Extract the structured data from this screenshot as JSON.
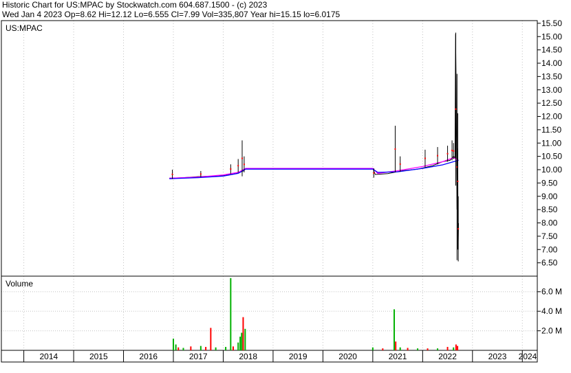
{
  "header": {
    "line1": "Historic Chart for US:MPAC by Stockwatch.com 604.687.1500 - (c) 2023",
    "line2": "Wed Jan  4 2023   Op=8.62  Hi=12.12  Lo=6.555  Cl=7.99  Vol=335,807  Year hi=15.15  lo=6.0175"
  },
  "colors": {
    "price": "#000000",
    "down_tick": "#ff0000",
    "ma_fast": "#ff00ff",
    "ma_slow": "#0000ff",
    "vol_up": "#00b000",
    "vol_down": "#ff0000",
    "grid": "#c0c0c0"
  },
  "chart_data": [
    {
      "type": "line",
      "symbol_label": "US:MPAC",
      "y_ticks": [
        "15.50",
        "15.00",
        "14.50",
        "14.00",
        "13.50",
        "13.00",
        "12.50",
        "12.00",
        "11.50",
        "11.00",
        "10.50",
        "10.00",
        "9.50",
        "9.00",
        "8.50",
        "8.00",
        "7.50",
        "7.00",
        "6.50"
      ],
      "ylim": [
        6.0,
        15.6
      ],
      "x_ticks": [
        "2014",
        "2015",
        "2016",
        "2017",
        "2018",
        "2019",
        "2020",
        "2021",
        "2022",
        "2023",
        "2024"
      ],
      "xlim": [
        2013.55,
        2024.3
      ],
      "series": [
        {
          "role": "close",
          "x": [
            2016.92,
            2017.2,
            2017.5,
            2017.8,
            2018.05,
            2018.25,
            2018.4,
            2018.45,
            2021.0,
            2021.05,
            2021.3,
            2021.6,
            2021.9,
            2022.2,
            2022.4,
            2022.55,
            2022.62,
            2022.65,
            2022.66,
            2022.67,
            2022.69,
            2022.7,
            2022.705,
            2022.71,
            2022.72
          ],
          "values": [
            9.68,
            9.7,
            9.74,
            9.76,
            9.79,
            9.85,
            9.95,
            10.05,
            10.05,
            9.82,
            9.85,
            9.96,
            10.02,
            10.15,
            10.3,
            10.35,
            10.5,
            10.45,
            15.1,
            13.5,
            8.5,
            9.1,
            10.8,
            7.0,
            7.99
          ]
        },
        {
          "role": "ma_fast",
          "x": [
            2016.92,
            2017.5,
            2018.0,
            2018.3,
            2018.45,
            2021.0,
            2021.1,
            2021.5,
            2022.0,
            2022.4,
            2022.62,
            2022.72
          ],
          "values": [
            9.68,
            9.72,
            9.8,
            9.9,
            10.05,
            10.05,
            9.86,
            9.96,
            10.12,
            10.3,
            10.45,
            10.35
          ]
        },
        {
          "role": "ma_slow",
          "x": [
            2016.92,
            2017.5,
            2018.0,
            2018.3,
            2018.45,
            2021.0,
            2021.1,
            2021.5,
            2022.0,
            2022.4,
            2022.62,
            2022.72
          ],
          "values": [
            9.66,
            9.7,
            9.76,
            9.86,
            10.02,
            10.02,
            9.9,
            9.92,
            10.05,
            10.18,
            10.3,
            10.35
          ]
        }
      ],
      "spikes": [
        {
          "x": 2016.98,
          "lo": 9.65,
          "hi": 10.0
        },
        {
          "x": 2017.55,
          "lo": 9.72,
          "hi": 9.95
        },
        {
          "x": 2018.15,
          "lo": 9.85,
          "hi": 10.2
        },
        {
          "x": 2018.3,
          "lo": 9.9,
          "hi": 10.4
        },
        {
          "x": 2018.38,
          "lo": 9.75,
          "hi": 11.1
        },
        {
          "x": 2018.42,
          "lo": 9.9,
          "hi": 10.5
        },
        {
          "x": 2021.02,
          "lo": 9.7,
          "hi": 10.05
        },
        {
          "x": 2021.45,
          "lo": 9.9,
          "hi": 11.65
        },
        {
          "x": 2021.55,
          "lo": 9.92,
          "hi": 10.5
        },
        {
          "x": 2022.05,
          "lo": 10.1,
          "hi": 10.75
        },
        {
          "x": 2022.3,
          "lo": 10.2,
          "hi": 10.85
        },
        {
          "x": 2022.5,
          "lo": 10.3,
          "hi": 10.9
        },
        {
          "x": 2022.59,
          "lo": 10.35,
          "hi": 11.1
        },
        {
          "x": 2022.62,
          "lo": 10.4,
          "hi": 11.0
        },
        {
          "x": 2022.665,
          "lo": 9.4,
          "hi": 15.15
        },
        {
          "x": 2022.69,
          "lo": 6.6,
          "hi": 13.6
        },
        {
          "x": 2022.705,
          "lo": 7.0,
          "hi": 12.12
        },
        {
          "x": 2022.715,
          "lo": 6.555,
          "hi": 9.0
        }
      ]
    },
    {
      "type": "bar",
      "title": "Volume",
      "y_ticks": [
        "6.0 M",
        "4.0 M",
        "2.0 M"
      ],
      "ylim": [
        0,
        7.6
      ],
      "units": "M",
      "bars": [
        {
          "x": 2017.0,
          "v": 1.2,
          "dir": "up"
        },
        {
          "x": 2017.05,
          "v": 0.6,
          "dir": "up"
        },
        {
          "x": 2017.1,
          "v": 0.3,
          "dir": "down"
        },
        {
          "x": 2017.2,
          "v": 0.25,
          "dir": "up"
        },
        {
          "x": 2017.35,
          "v": 0.4,
          "dir": "down"
        },
        {
          "x": 2017.55,
          "v": 0.45,
          "dir": "up"
        },
        {
          "x": 2017.65,
          "v": 0.35,
          "dir": "down"
        },
        {
          "x": 2017.75,
          "v": 2.3,
          "dir": "down"
        },
        {
          "x": 2017.85,
          "v": 0.3,
          "dir": "up"
        },
        {
          "x": 2018.05,
          "v": 0.35,
          "dir": "up"
        },
        {
          "x": 2018.15,
          "v": 7.4,
          "dir": "up"
        },
        {
          "x": 2018.2,
          "v": 0.4,
          "dir": "down"
        },
        {
          "x": 2018.3,
          "v": 0.8,
          "dir": "up"
        },
        {
          "x": 2018.34,
          "v": 1.4,
          "dir": "up"
        },
        {
          "x": 2018.37,
          "v": 1.8,
          "dir": "up"
        },
        {
          "x": 2018.4,
          "v": 3.4,
          "dir": "down"
        },
        {
          "x": 2018.44,
          "v": 2.2,
          "dir": "up"
        },
        {
          "x": 2021.0,
          "v": 0.3,
          "dir": "up"
        },
        {
          "x": 2021.2,
          "v": 0.2,
          "dir": "down"
        },
        {
          "x": 2021.43,
          "v": 4.2,
          "dir": "up"
        },
        {
          "x": 2021.46,
          "v": 0.9,
          "dir": "down"
        },
        {
          "x": 2021.55,
          "v": 0.3,
          "dir": "up"
        },
        {
          "x": 2021.7,
          "v": 0.25,
          "dir": "down"
        },
        {
          "x": 2021.9,
          "v": 0.2,
          "dir": "up"
        },
        {
          "x": 2022.1,
          "v": 0.2,
          "dir": "down"
        },
        {
          "x": 2022.3,
          "v": 0.2,
          "dir": "up"
        },
        {
          "x": 2022.5,
          "v": 0.35,
          "dir": "down"
        },
        {
          "x": 2022.62,
          "v": 0.3,
          "dir": "up"
        },
        {
          "x": 2022.67,
          "v": 0.6,
          "dir": "down"
        },
        {
          "x": 2022.7,
          "v": 0.45,
          "dir": "down"
        }
      ]
    }
  ]
}
